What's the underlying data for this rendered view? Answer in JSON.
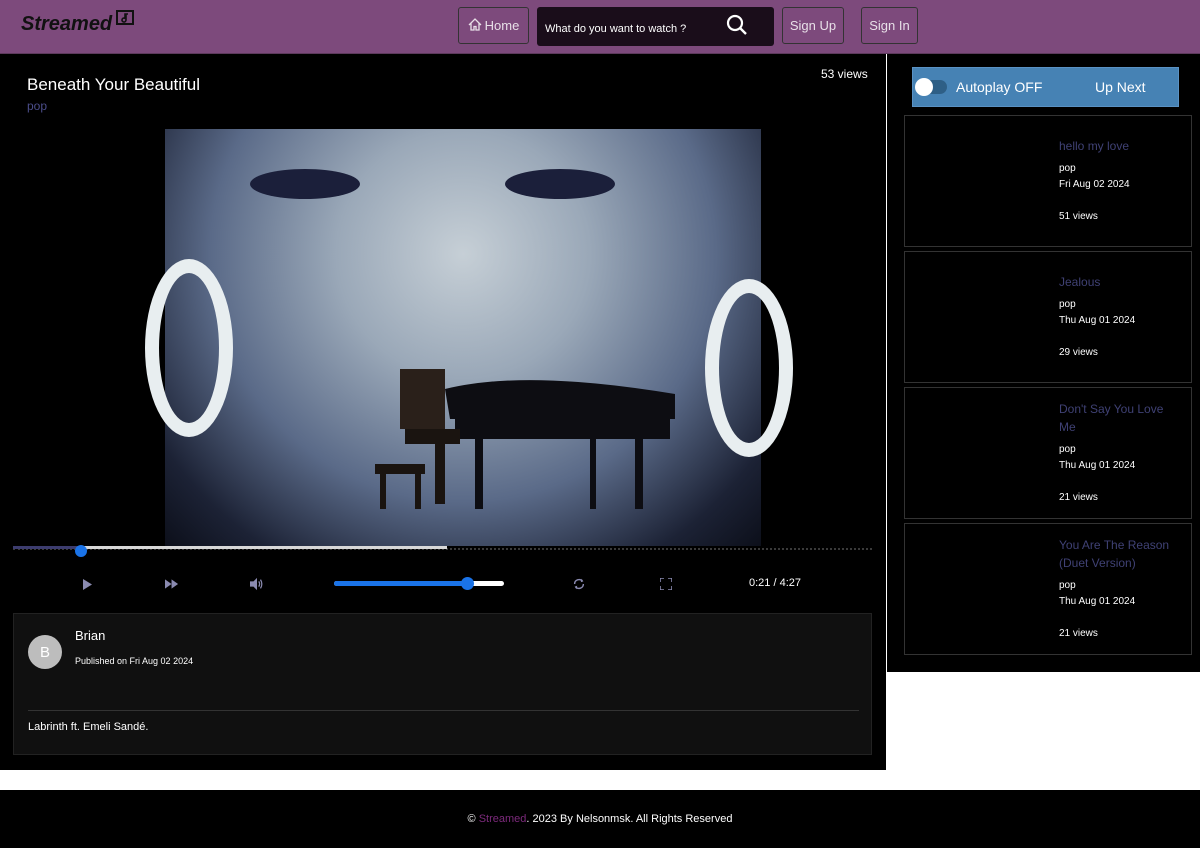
{
  "header": {
    "logo_text": "Streamed",
    "home_label": "Home",
    "search_placeholder": "What do you want to watch ?",
    "signup_label": "Sign Up",
    "signin_label": "Sign In"
  },
  "video": {
    "title": "Beneath Your Beautiful",
    "category": "pop",
    "views": "53 views",
    "current_time": "0:21",
    "time_separator": "/",
    "duration": "4:27",
    "progress_fraction": 0.079,
    "buffered_fraction": 0.505,
    "volume_fraction": 0.78
  },
  "info": {
    "avatar_initial": "B",
    "author": "Brian",
    "published": "Published on Fri Aug 02 2024",
    "description": "Labrinth ft. Emeli Sandé."
  },
  "sidebar": {
    "autoplay_label": "Autoplay OFF",
    "upnext_label": "Up Next",
    "items": [
      {
        "title": "hello my love",
        "category": "pop",
        "date": "Fri Aug 02 2024",
        "views": "51 views"
      },
      {
        "title": "Jealous",
        "category": "pop",
        "date": "Thu Aug 01 2024",
        "views": "29 views"
      },
      {
        "title": "Don't Say You Love Me",
        "category": "pop",
        "date": "Thu Aug 01 2024",
        "views": "21 views"
      },
      {
        "title": "You Are The Reason (Duet Version)",
        "category": "pop",
        "date": "Thu Aug 01 2024",
        "views": "21 views"
      }
    ]
  },
  "footer": {
    "copyright": "©",
    "brand": "Streamed",
    "rest": ". 2023  By Nelsonmsk. All Rights Reserved"
  },
  "colors": {
    "header_bg": "#7d4a7c",
    "accent_blue": "#1a73e8",
    "autoplay_bg": "#4682b4",
    "link_muted": "#3f4174"
  }
}
